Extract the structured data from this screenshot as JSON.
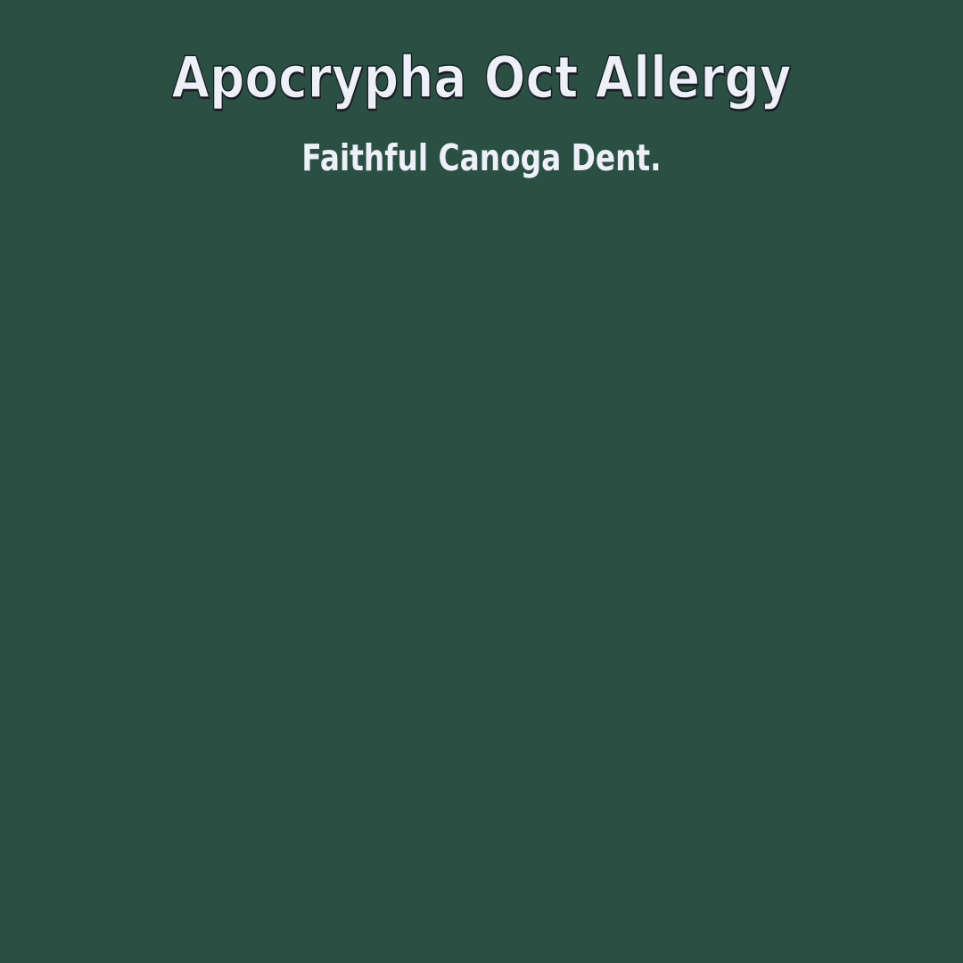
{
  "canvas": {
    "background_color": "#2a5044"
  },
  "header": {
    "title": "Apocrypha Oct Allergy",
    "subtitle": "Faithful Canoga Dent.",
    "text_color": "#eef0f8",
    "outline_color": "#1a1f24"
  }
}
